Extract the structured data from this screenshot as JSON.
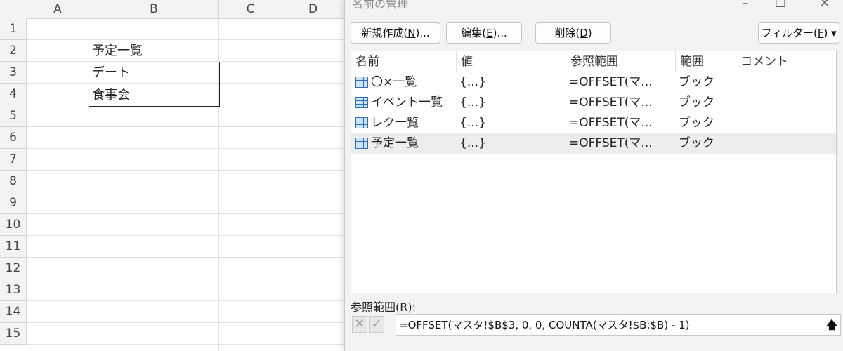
{
  "sheet": {
    "columns": [
      "A",
      "B",
      "C",
      "D"
    ],
    "rows": [
      "1",
      "2",
      "3",
      "4",
      "5",
      "6",
      "7",
      "8",
      "9",
      "10",
      "11",
      "12",
      "13",
      "14",
      "15"
    ],
    "cells": {
      "b2": "予定一覧",
      "b3": "デート",
      "b4": "食事会"
    }
  },
  "dialog": {
    "title": "名前の管理",
    "buttons": {
      "new_prefix": "新規作成(",
      "new_key": "N",
      "new_suffix": ")...",
      "edit_prefix": "編集(",
      "edit_key": "E",
      "edit_suffix": ")...",
      "delete_prefix": "削除(",
      "delete_key": "D",
      "delete_suffix": ")",
      "filter_prefix": "フィルター(",
      "filter_key": "F",
      "filter_suffix": ")",
      "filter_arrow": "▾"
    },
    "list": {
      "headers": {
        "name": "名前",
        "value": "値",
        "refers_to": "参照範囲",
        "scope": "範囲",
        "comment": "コメント"
      },
      "rows": [
        {
          "name": "〇×一覧",
          "value": "{...}",
          "refers_to": "=OFFSET(マ...",
          "scope": "ブック",
          "comment": ""
        },
        {
          "name": "イベント一覧",
          "value": "{...}",
          "refers_to": "=OFFSET(マ...",
          "scope": "ブック",
          "comment": ""
        },
        {
          "name": "レク一覧",
          "value": "{...}",
          "refers_to": "=OFFSET(マ...",
          "scope": "ブック",
          "comment": ""
        },
        {
          "name": "予定一覧",
          "value": "{...}",
          "refers_to": "=OFFSET(マ...",
          "scope": "ブック",
          "comment": ""
        }
      ]
    },
    "refers_to_label_prefix": "参照範囲(",
    "refers_to_label_key": "R",
    "refers_to_label_suffix": "):",
    "refers_to_value": "=OFFSET(マスタ!$B$3, 0, 0, COUNTA(マスタ!$B:$B) - 1)",
    "icons": {
      "cancel": "✕",
      "confirm": "✓",
      "collapse": "🡅",
      "minimize": "–",
      "maximize": "☐",
      "close": "✕"
    },
    "accent": "#2e6fb8",
    "selected_row_color": "#ededed"
  }
}
